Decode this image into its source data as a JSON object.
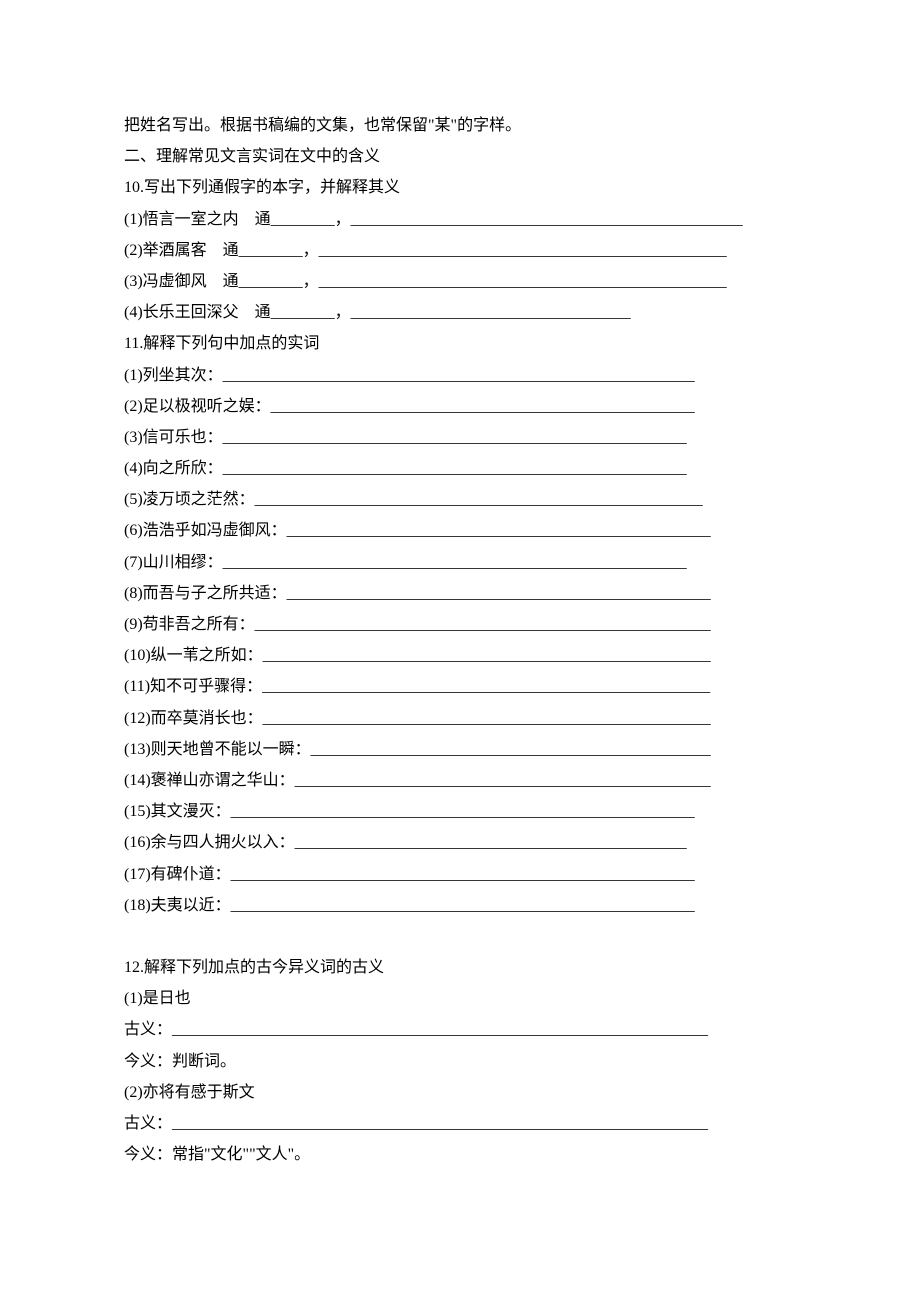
{
  "lines": [
    "把姓名写出。根据书稿编的文集，也常保留\"某\"的字样。",
    "二、理解常见文言实词在文中的含义",
    "10.写出下列通假字的本字，并解释其义",
    "(1)悟言一室之内　通________，_________________________________________________",
    "(2)举酒属客　通________，___________________________________________________",
    "(3)冯虚御风　通________，___________________________________________________",
    "(4)长乐王回深父　通________，___________________________________",
    "11.解释下列句中加点的实词",
    "(1)列坐其次：___________________________________________________________",
    "(2)足以极视听之娱：_____________________________________________________",
    "(3)信可乐也：__________________________________________________________",
    "(4)向之所欣：__________________________________________________________",
    "(5)凌万顷之茫然：________________________________________________________",
    "(6)浩浩乎如冯虚御风：_____________________________________________________",
    "(7)山川相缪：__________________________________________________________",
    "(8)而吾与子之所共适：_____________________________________________________",
    "(9)苟非吾之所有：_________________________________________________________",
    "(10)纵一苇之所如：________________________________________________________",
    "(11)知不可乎骤得：________________________________________________________",
    "(12)而卒莫消长也：________________________________________________________",
    "(13)则天地曾不能以一瞬：__________________________________________________",
    "(14)褒禅山亦谓之华山：____________________________________________________",
    "(15)其文漫灭：__________________________________________________________",
    "(16)余与四人拥火以入：_________________________________________________",
    "(17)有碑仆道：__________________________________________________________",
    "(18)夫夷以近：__________________________________________________________",
    "",
    "12.解释下列加点的古今异义词的古义",
    "(1)是日也",
    "古义：___________________________________________________________________",
    "今义：判断词。",
    "(2)亦将有感于斯文",
    "古义：___________________________________________________________________",
    "今义：常指\"文化\"\"文人\"。"
  ]
}
